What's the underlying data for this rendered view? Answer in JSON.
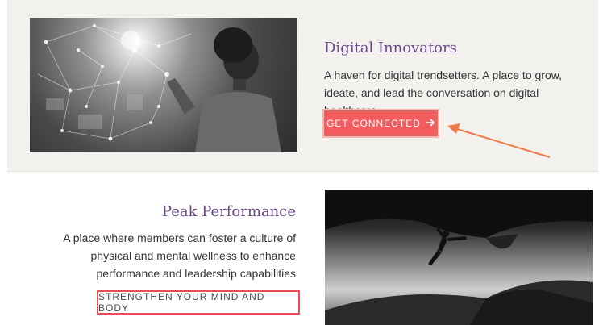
{
  "sections": [
    {
      "title": "Digital Innovators",
      "description": "A haven for digital trendsetters. A place to grow, ideate, and lead the conversation on digital healthcare.",
      "button_label": "GET CONNECTED",
      "button_icon": "arrow-right-icon"
    },
    {
      "title": "Peak Performance",
      "description": "A place where members can foster a culture of physical and mental wellness to enhance performance and leadership capabilities",
      "button_label": "STRENGTHEN YOUR MIND AND BODY"
    }
  ],
  "colors": {
    "title": "#6d4a8c",
    "button_primary": "#f25c5f",
    "outline_button_border": "#e84c55",
    "annotation_arrow": "#f07a45"
  }
}
